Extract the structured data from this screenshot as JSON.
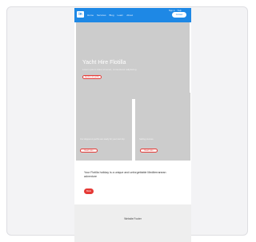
{
  "nav": {
    "logo": "in",
    "links": [
      "Home",
      "Services",
      "Blog",
      "Learn",
      "About"
    ],
    "top_links": [
      "Sign in",
      "Help"
    ],
    "cta": "Contact"
  },
  "hero": {
    "title": "Yacht Hire Flotilla",
    "subtitle": "Lorem ipsum dolor sit amet, consectetur adipiscing",
    "button": "Explore all yachts"
  },
  "tiles": [
    {
      "text": "Our skippered yachts are ready for your next trip",
      "button": "Read more"
    },
    {
      "text": "Sailing courses",
      "button": "Read more"
    }
  ],
  "promo": {
    "text": "Your Flotilla holiday is a unique and unforgettable Mediterranean adventure",
    "button": "Book"
  },
  "footer": {
    "label": "Website Footer"
  }
}
